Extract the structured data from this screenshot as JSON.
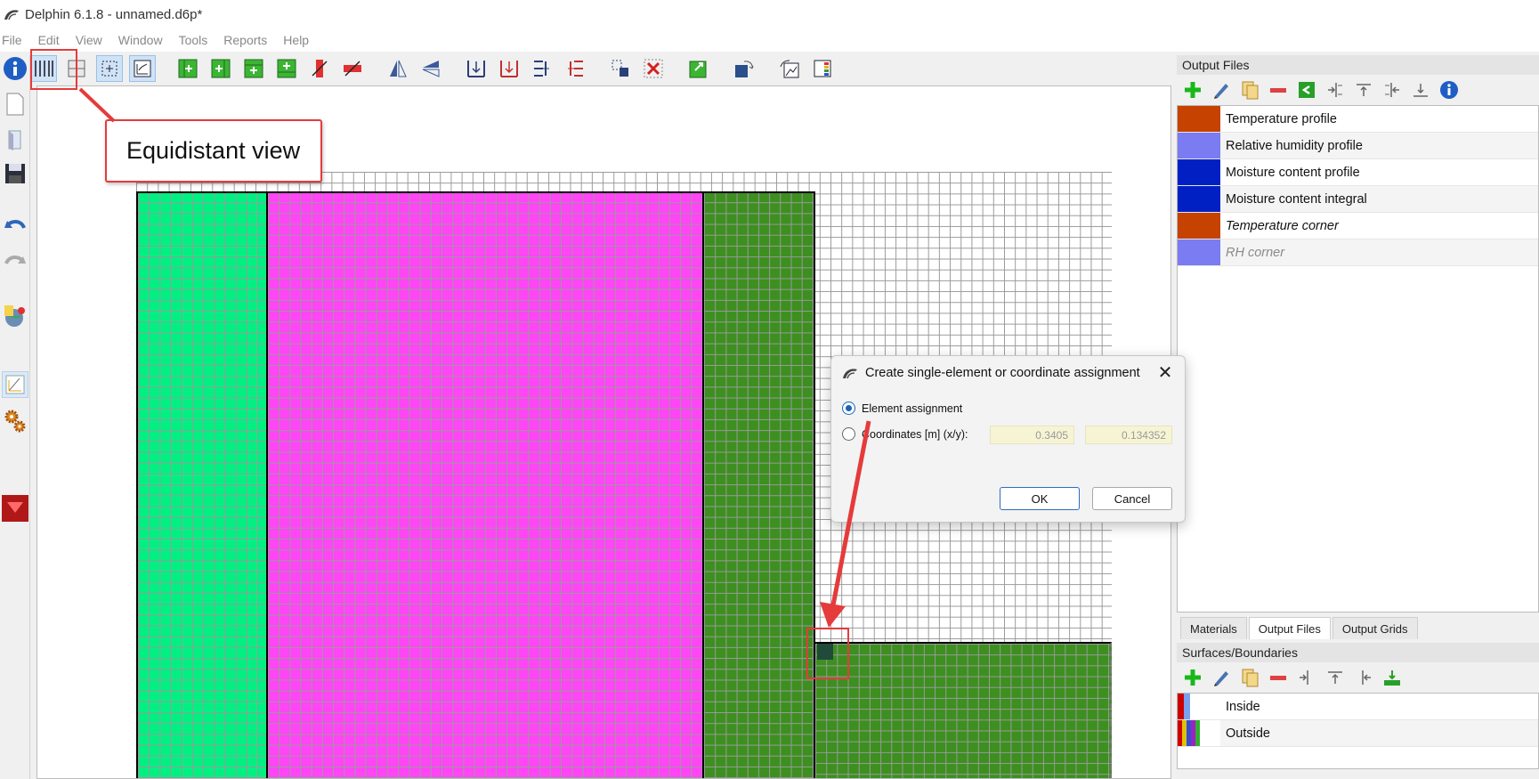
{
  "window": {
    "title": "Delphin 6.1.8 - unnamed.d6p*"
  },
  "menu": [
    "File",
    "Edit",
    "View",
    "Window",
    "Tools",
    "Reports",
    "Help"
  ],
  "toolbar": {
    "icons": [
      "equidistant-view-icon",
      "grid-view-icon",
      "select-view-icon",
      "table-view-icon",
      "insert-column-left-icon",
      "insert-column-right-icon",
      "insert-row-above-icon",
      "insert-row-below-icon",
      "delete-column-icon",
      "delete-row-icon",
      "mirror-vertical-icon",
      "mirror-horizontal-icon",
      "split-column-icon",
      "split-row-icon",
      "merge-left-icon",
      "merge-right-icon",
      "select-region-icon",
      "delete-assignment-icon",
      "assign-material-icon",
      "rotate-3d-icon",
      "export-chart-icon",
      "color-table-icon"
    ]
  },
  "callout": {
    "text": "Equidistant view"
  },
  "output_files": {
    "header": "Output Files",
    "items": [
      {
        "label": "Temperature profile",
        "color": "#c54200",
        "style": "normal"
      },
      {
        "label": "Relative humidity profile",
        "color": "#7b7bf2",
        "style": "normal"
      },
      {
        "label": "Moisture content profile",
        "color": "#0020c4",
        "style": "normal"
      },
      {
        "label": "Moisture content integral",
        "color": "#0020c4",
        "style": "normal"
      },
      {
        "label": "Temperature corner",
        "color": "#c54200",
        "style": "italic"
      },
      {
        "label": "RH corner",
        "color": "#7b7bf2",
        "style": "dim"
      }
    ]
  },
  "tabs": [
    {
      "label": "Materials",
      "active": false
    },
    {
      "label": "Output Files",
      "active": true
    },
    {
      "label": "Output Grids",
      "active": false
    }
  ],
  "surfaces": {
    "header": "Surfaces/Boundaries",
    "items": [
      {
        "label": "Inside"
      },
      {
        "label": "Outside"
      }
    ]
  },
  "dialog": {
    "title": "Create single-element or coordinate assignment",
    "option_element": "Element assignment",
    "option_coordinates": "Coordinates [m] (x/y):",
    "x_value": "0.3405",
    "y_value": "0.134352",
    "ok": "OK",
    "cancel": "Cancel",
    "selected": "element"
  },
  "colors": {
    "material_green_light": "#00f082",
    "material_magenta": "#ff45f6",
    "material_green_dark": "#3d8f20",
    "selected_element": "#214a3a",
    "annotation_red": "#e53b3b"
  }
}
